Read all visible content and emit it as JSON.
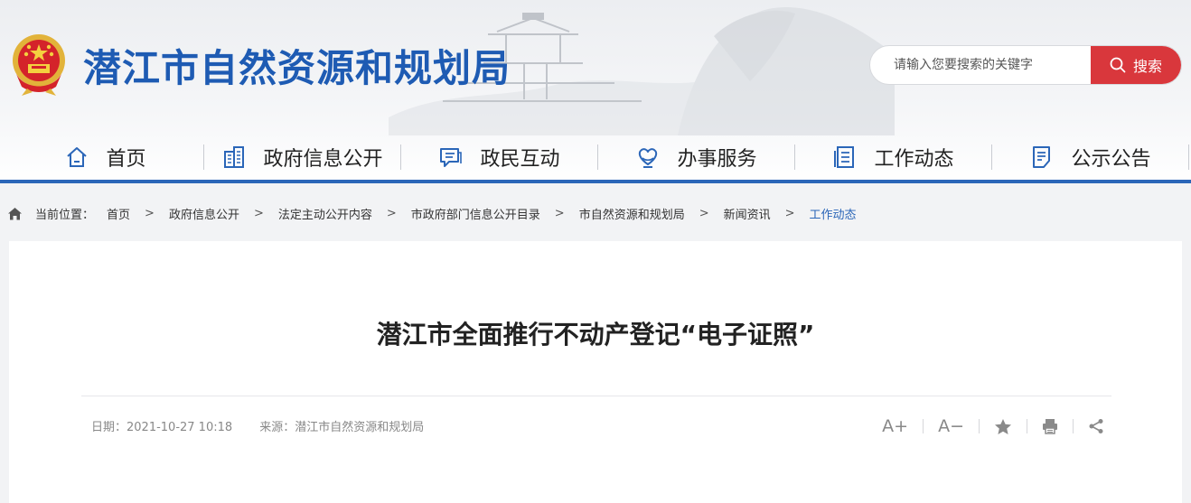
{
  "header": {
    "site_title": "潜江市自然资源和规划局"
  },
  "search": {
    "placeholder": "请输入您要搜索的关键字",
    "button_label": "搜索"
  },
  "nav": {
    "items": [
      {
        "label": "首页",
        "icon": "home-icon"
      },
      {
        "label": "政府信息公开",
        "icon": "building-icon"
      },
      {
        "label": "政民互动",
        "icon": "chat-icon"
      },
      {
        "label": "办事服务",
        "icon": "heart-hand-icon"
      },
      {
        "label": "工作动态",
        "icon": "document-list-icon"
      },
      {
        "label": "公示公告",
        "icon": "notice-icon"
      }
    ]
  },
  "breadcrumb": {
    "prefix": "当前位置：",
    "separator": ">",
    "items": [
      "首页",
      "政府信息公开",
      "法定主动公开内容",
      "市政府部门信息公开目录",
      "市自然资源和规划局",
      "新闻资讯",
      "工作动态"
    ]
  },
  "article": {
    "title": "潜江市全面推行不动产登记“电子证照”",
    "date_text": "日期：2021-10-27 10:18",
    "source_text": "来源：潜江市自然资源和规划局"
  },
  "tools": {
    "font_increase": "A+",
    "font_decrease": "A−"
  },
  "colors": {
    "brand_blue": "#2b66b8",
    "title_blue": "#1e5bb3",
    "search_red": "#d9373c"
  }
}
